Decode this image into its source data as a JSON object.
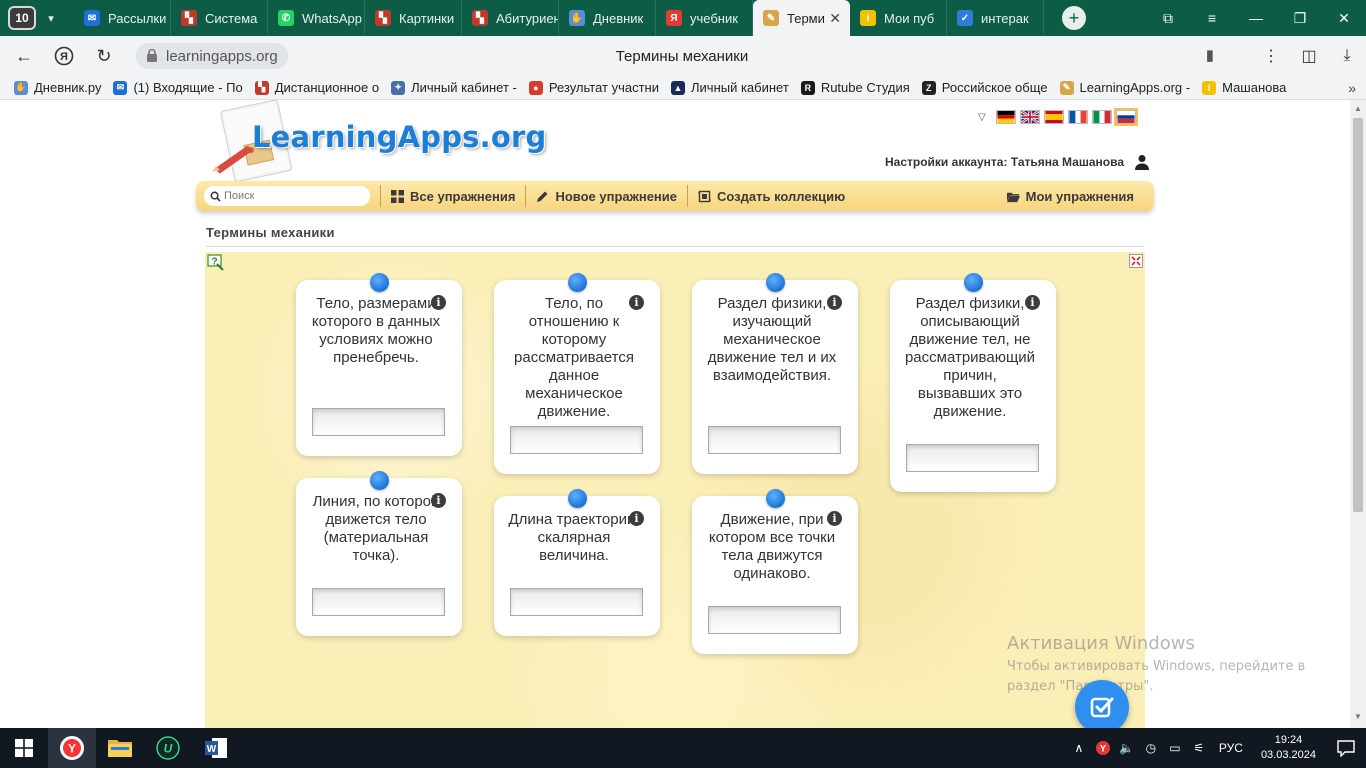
{
  "browser": {
    "tab_count": "10",
    "tabs": [
      {
        "label": "Рассылки",
        "icon": "mail-icon",
        "color": "#1e6fd9",
        "active": false
      },
      {
        "label": "Система",
        "icon": "flag-icon",
        "color": "#c0392b",
        "active": false
      },
      {
        "label": "WhatsApp",
        "icon": "whatsapp-icon",
        "color": "#25d366",
        "active": false
      },
      {
        "label": "Картинки",
        "icon": "flag-icon",
        "color": "#c0392b",
        "active": false
      },
      {
        "label": "Абитуриент",
        "icon": "flag-icon",
        "color": "#c0392b",
        "active": false
      },
      {
        "label": "Дневник",
        "icon": "hand-icon",
        "color": "#5b8dd6",
        "active": false
      },
      {
        "label": "учебник",
        "icon": "yandex-icon",
        "color": "#e53935",
        "active": false
      },
      {
        "label": "Терми",
        "icon": "learningapps-icon",
        "color": "#d8a64a",
        "active": true
      },
      {
        "label": "Мои пуб",
        "icon": "info-icon",
        "color": "#f2c200",
        "active": false
      },
      {
        "label": "интерак",
        "icon": "check-icon",
        "color": "#2e7dd8",
        "active": false
      }
    ],
    "address": {
      "domain": "learningapps.org",
      "page_title": "Термины механики"
    },
    "bookmarks": [
      {
        "label": "Дневник.ру",
        "icon": "hand-icon",
        "color": "#5b8dd6"
      },
      {
        "label": "(1) Входящие - По",
        "icon": "mail-icon",
        "color": "#1e6fd9"
      },
      {
        "label": "Дистанционное о",
        "icon": "flag-icon",
        "color": "#c0392b"
      },
      {
        "label": "Личный кабинет -",
        "icon": "emblem-icon",
        "color": "#4a6ea9"
      },
      {
        "label": "Результат участни",
        "icon": "apple-icon",
        "color": "#d63b2b"
      },
      {
        "label": "Личный кабинет",
        "icon": "graduation-cap-icon",
        "color": "#1a2a5a"
      },
      {
        "label": "Rutube Студия",
        "icon": "rutube-icon",
        "color": "#1a1a1a"
      },
      {
        "label": "Российское обще",
        "icon": "z-icon",
        "color": "#222222"
      },
      {
        "label": "LearningApps.org -",
        "icon": "learningapps-icon",
        "color": "#d8a64a"
      },
      {
        "label": "Машанова",
        "icon": "info-icon",
        "color": "#f2c200"
      }
    ]
  },
  "site": {
    "logo_text": "LearningApps.org",
    "account_label": "Настройки аккаунта: Татьяна Машанова",
    "languages": [
      "de",
      "en",
      "es",
      "fr",
      "it",
      "ru"
    ],
    "selected_language": "ru",
    "menu": {
      "search_placeholder": "Поиск",
      "all_exercises": "Все упражнения",
      "new_exercise": "Новое упражнение",
      "create_collection": "Создать коллекцию",
      "my_exercises": "Мои упражнения"
    },
    "exercise_title": "Термины механики"
  },
  "exercise": {
    "info_glyph": "i",
    "cards": [
      {
        "text": "Тело, размерами которого в данных условиях можно пренебречь.",
        "answer": ""
      },
      {
        "text": "Тело, по отношению к которому рассматривается данное механическое движение.",
        "answer": ""
      },
      {
        "text": "Раздел физики, изучающий механическое движение тел и их взаимодействия.",
        "answer": ""
      },
      {
        "text": "Раздел физики, описывающий движение тел, не рассматривающий причин, вызвавших это движение.",
        "answer": ""
      },
      {
        "text": "Линия, по которой движется тело (материальная точка).",
        "answer": ""
      },
      {
        "text": "Длина траектории, скалярная величина.",
        "answer": ""
      },
      {
        "text": "Движение, при котором все точки тела движутся одинаково.",
        "answer": ""
      }
    ]
  },
  "watermark": {
    "title": "Активация Windows",
    "line1": "Чтобы активировать Windows, перейдите в",
    "line2": "раздел \"Параметры\"."
  },
  "taskbar": {
    "language": "РУС",
    "time": "19:24",
    "date": "03.03.2024"
  },
  "colors": {
    "tabbar": "#0d5c46",
    "menubar": "#f8d57f",
    "logo": "#1c7fd6",
    "app_bg": "#fbefb8",
    "pin": "#1d73d6"
  }
}
